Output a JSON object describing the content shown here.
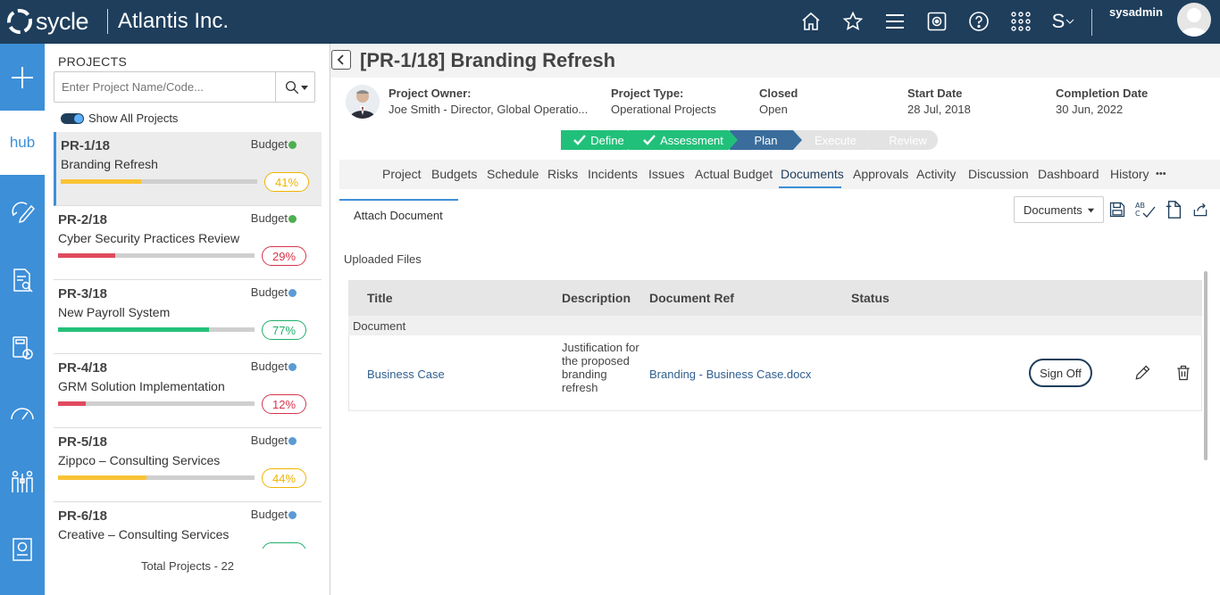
{
  "topbar": {
    "logo_text": "sycle",
    "company": "Atlantis Inc.",
    "username": "sysadmin",
    "icons": [
      "home-icon",
      "star-icon",
      "menu-icon",
      "settings-box-icon",
      "help-icon",
      "apps-grid-icon",
      "s-dropdown-icon"
    ],
    "s_menu_label": "S"
  },
  "rail": {
    "hub_label": "hub",
    "icons": [
      "plus-icon",
      "hub-icon",
      "edit-cycle-icon",
      "document-search-icon",
      "calculator-clock-icon",
      "gauge-icon",
      "people-chart-icon",
      "report-icon"
    ]
  },
  "projects": {
    "heading": "PROJECTS",
    "search_placeholder": "Enter Project Name/Code...",
    "toggle_label": "Show All Projects",
    "budget_label": "Budget",
    "footer": "Total Projects - 22",
    "items": [
      {
        "code": "PR-1/18",
        "name": "Branding Refresh",
        "pct": "41%",
        "progress": 0.41,
        "bar_color": "#f9c335",
        "dot_color": "#4caf50",
        "pct_color": "#f0b400"
      },
      {
        "code": "PR-2/18",
        "name": "Cyber Security Practices Review",
        "pct": "29%",
        "progress": 0.29,
        "bar_color": "#e04a5f",
        "dot_color": "#4caf50",
        "pct_color": "#d8344b"
      },
      {
        "code": "PR-3/18",
        "name": "New Payroll System",
        "pct": "77%",
        "progress": 0.77,
        "bar_color": "#26c07a",
        "dot_color": "#5b9bd5",
        "pct_color": "#1fae6a"
      },
      {
        "code": "PR-4/18",
        "name": "GRM Solution Implementation",
        "pct": "12%",
        "progress": 0.14,
        "bar_color": "#e04a5f",
        "dot_color": "#5b9bd5",
        "pct_color": "#d8344b"
      },
      {
        "code": "PR-5/18",
        "name": "Zippco – Consulting Services",
        "pct": "44%",
        "progress": 0.45,
        "bar_color": "#f9c335",
        "dot_color": "#5b9bd5",
        "pct_color": "#f0b400"
      },
      {
        "code": "PR-6/18",
        "name": "Creative – Consulting Services",
        "pct": "",
        "progress": 0,
        "bar_color": "#26c07a",
        "dot_color": "#5b9bd5",
        "pct_color": "#1fae6a"
      }
    ]
  },
  "project": {
    "title": "[PR-1/18] Branding Refresh",
    "owner_label": "Project Owner:",
    "owner_value": "Joe Smith - Director, Global Operatio...",
    "type_label": "Project Type:",
    "type_value": "Operational Projects",
    "status_label": "Closed",
    "status_value": "Open",
    "start_label": "Start Date",
    "start_value": "28 Jul, 2018",
    "completion_label": "Completion Date",
    "completion_value": "30 Jun, 2022"
  },
  "stages": [
    {
      "label": "Define",
      "state": "done"
    },
    {
      "label": "Assessment",
      "state": "done"
    },
    {
      "label": "Plan",
      "state": "current"
    },
    {
      "label": "Execute",
      "state": "future"
    },
    {
      "label": "Review",
      "state": "future"
    }
  ],
  "tabs": [
    "Project",
    "Budgets",
    "Schedule",
    "Risks",
    "Incidents",
    "Issues",
    "Actual Budget",
    "Documents",
    "Approvals",
    "Activity",
    "Discussion",
    "Dashboard",
    "History",
    "•••"
  ],
  "active_tab": "Documents",
  "documents": {
    "sub_tab": "Attach Document",
    "select_value": "Documents",
    "section_title": "Uploaded Files",
    "columns": [
      "Title",
      "Description",
      "Document Ref",
      "Status"
    ],
    "group": "Document",
    "rows": [
      {
        "title": "Business Case",
        "description": "Justification for the proposed branding refresh",
        "ref": "Branding - Business Case.docx",
        "status": "",
        "action": "Sign Off"
      }
    ]
  },
  "colors": {
    "topbar": "#1e3e5c",
    "rail": "#3d8fd8",
    "stage_done": "#21c07a",
    "stage_current": "#3a6d9c",
    "stage_future": "#e3e3e3"
  }
}
